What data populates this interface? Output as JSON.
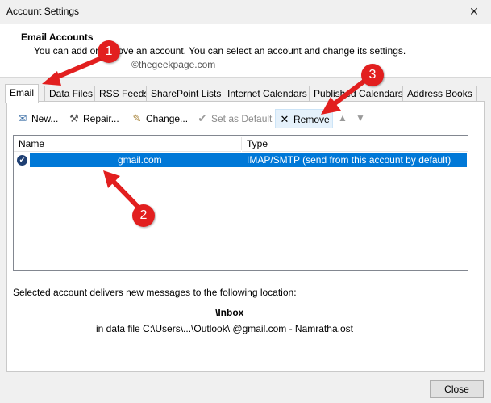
{
  "window": {
    "title": "Account Settings",
    "close_glyph": "✕"
  },
  "header": {
    "title": "Email Accounts",
    "description": "You can add or remove an account. You can select an account and change its settings.",
    "watermark": "©thegeekpage.com"
  },
  "tabs": [
    {
      "label": "Email",
      "active": true
    },
    {
      "label": "Data Files"
    },
    {
      "label": "RSS Feeds"
    },
    {
      "label": "SharePoint Lists"
    },
    {
      "label": "Internet Calendars"
    },
    {
      "label": "Published Calendars"
    },
    {
      "label": "Address Books"
    }
  ],
  "toolbar": {
    "new_label": "New...",
    "repair_label": "Repair...",
    "change_label": "Change...",
    "set_default_label": "Set as Default",
    "remove_label": "Remove",
    "icons": {
      "new": "mail-icon",
      "repair": "tools-icon",
      "change": "edit-icon",
      "set_default": "check-circle-icon",
      "remove": "x-icon",
      "up": "arrow-up-icon",
      "down": "arrow-down-icon"
    }
  },
  "accounts_table": {
    "columns": [
      "Name",
      "Type"
    ],
    "rows": [
      {
        "name": "gmail.com",
        "type": "IMAP/SMTP (send from this account by default)",
        "default": true,
        "selected": true
      }
    ]
  },
  "delivery": {
    "label": "Selected account delivers new messages to the following location:",
    "folder": "\\Inbox",
    "file": "in data file C:\\Users\\...\\Outlook\\                    @gmail.com - Namratha.ost"
  },
  "footer": {
    "close_label": "Close"
  },
  "annotations": {
    "badges": [
      "1",
      "2",
      "3"
    ],
    "color": "#e21f1f"
  },
  "colors": {
    "selection": "#0078d7",
    "annotation": "#e21f1f"
  }
}
